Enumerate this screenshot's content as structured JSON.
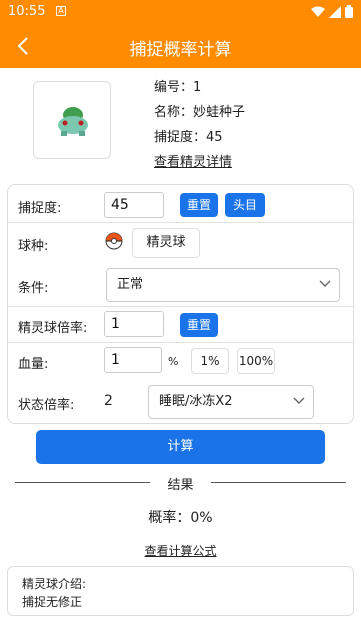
{
  "status": {
    "time": "10:55",
    "app_icon": "A"
  },
  "appbar": {
    "title": "捕捉概率计算",
    "back_icon": "chevron-left-icon"
  },
  "pokemon": {
    "number_label": "编号：1",
    "name_label": "名称：妙蛙种子",
    "catch_rate_label": "捕捉度：45",
    "detail_link": "查看精灵详情"
  },
  "form": {
    "catch_rate": {
      "label": "捕捉度:",
      "value": "45",
      "reset": "重置",
      "head": "头目"
    },
    "ball": {
      "label": "球种:",
      "value": "精灵球"
    },
    "condition": {
      "label": "条件:",
      "value": "正常"
    },
    "ball_multiplier": {
      "label": "精灵球倍率:",
      "value": "1",
      "reset": "重置"
    },
    "hp": {
      "label": "血量:",
      "value": "1",
      "unit": "%",
      "preset1": "1%",
      "preset2": "100%"
    },
    "status_multiplier": {
      "label": "状态倍率:",
      "value": "2",
      "select": "睡眠/冰冻X2"
    }
  },
  "calc_button": "计算",
  "result": {
    "title": "结果",
    "probability": "概率：0%",
    "formula_link": "查看计算公式"
  },
  "intro": {
    "title": "精灵球介绍:",
    "text": "捕捉无修正"
  },
  "colors": {
    "accent": "#ff8c00",
    "primary": "#1a73e8"
  }
}
